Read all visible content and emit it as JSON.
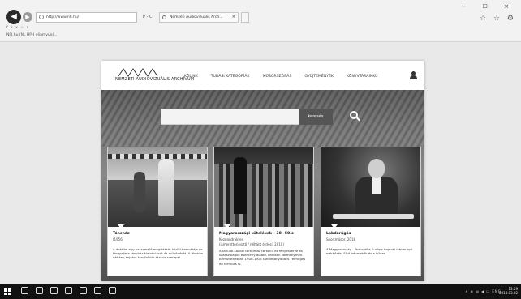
{
  "browser": {
    "address": "http://www.nfi.hu/",
    "address_actions": "P - C",
    "tab_title": "Nemzeti Audiovizuális Arch...",
    "tab_close": "×",
    "menu": "f x x ☆ a",
    "favorites": "NFI.hu (NL HPH eliamvue)...",
    "window_controls": "− ☐ ×",
    "tool_icons": "☆ ☆ ⚙"
  },
  "site": {
    "logo_text": "NEMZETI AUDIOVIZUÁLIS ARCHÍVUM",
    "nav": [
      "KÖLINK",
      "TUDÁSI KATEGÓRÍÁK",
      "MŰSORSZÓRÁS",
      "GYŰJTEMÉNYEK",
      "KÖNYVTÁRAINKÚ"
    ],
    "search_button": "keresés"
  },
  "cards": [
    {
      "title": "Táncház",
      "subtitle": "(1956)",
      "description": "A dokfilm egy vasszerelő meglátását körüli bemutatja és tárgyalja a táncház kialakulását és működését. A filmben néhány sajátos táncfolklór táncos szerepel."
    },
    {
      "title": "Magyarországi kötelékek – 30.–50.s",
      "subtitle": "Kezpandraktes\n(ismeretterjesztő / néhánt érdesi, 2010)",
      "description": "A tanulói-sokkal tartalmaz tarkálni és fényeszerze és szakszólagos esemény-alábbi. Párosán kormánymén. Bemutathatunk 1900-1915 tanulmányába is Felmégés éa termilés is."
    },
    {
      "title": "Labdarúgás",
      "subtitle": "Sportműsor, 2018",
      "description": "A Magyarország - Portugália Európa-bajnoki labdarúgó mérkőzés. Első bérzsebők és a hűves..."
    }
  ],
  "taskbar": {
    "tray": "∧  ⊕  ▤  ◀  ☐  ENG",
    "time": "13:29",
    "date": "2018.03.02"
  },
  "icons": [
    "back-icon",
    "forward-icon",
    "user-icon",
    "search-icon",
    "windows-icon"
  ]
}
